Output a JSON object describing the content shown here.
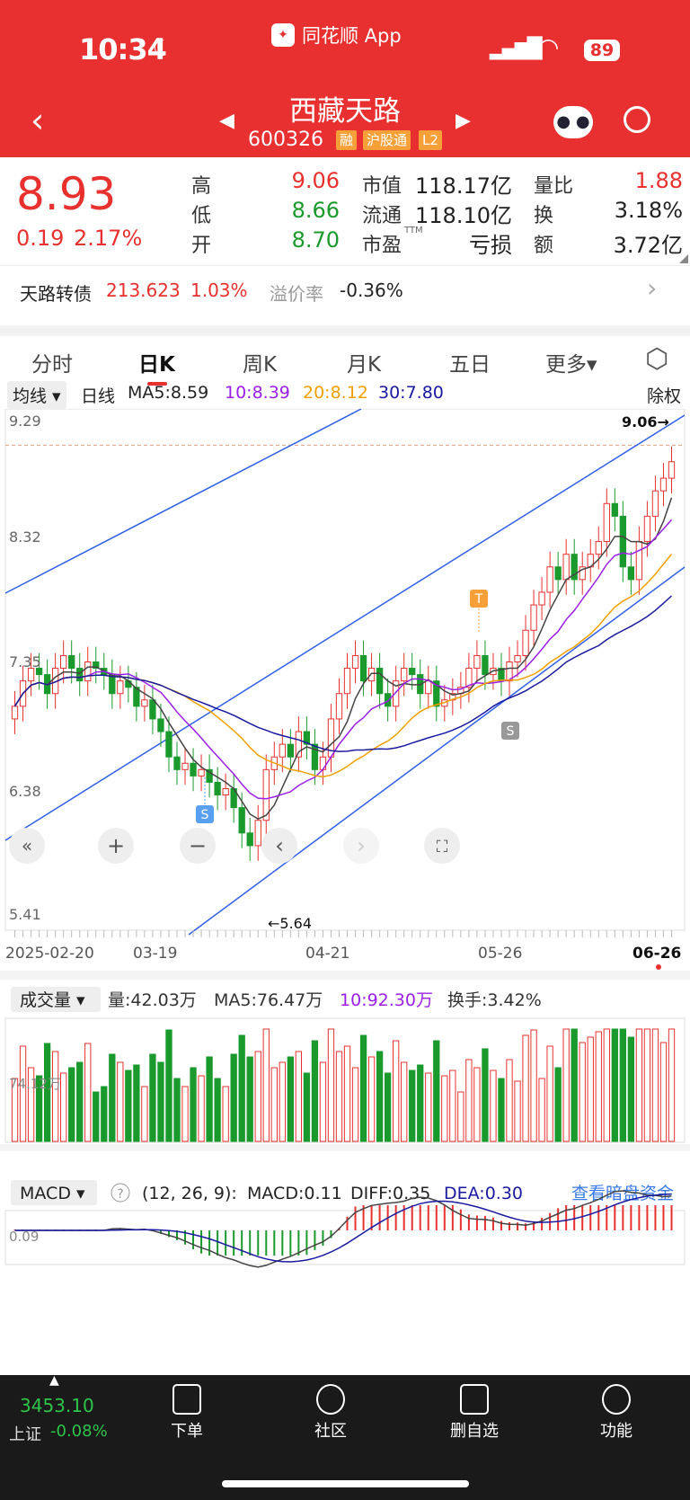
{
  "status": {
    "time": "10:34",
    "app": "同花顺 App",
    "battery": "89"
  },
  "header": {
    "name": "西藏天路",
    "code": "600326",
    "tags": [
      "融",
      "沪股通",
      "L2"
    ]
  },
  "quote": {
    "price": "8.93",
    "change": "0.19",
    "change_pct": "2.17%",
    "high_label": "高",
    "high": "9.06",
    "low_label": "低",
    "low": "8.66",
    "open_label": "开",
    "open": "8.70",
    "mktcap_label": "市值",
    "mktcap": "118.17亿",
    "float_label": "流通",
    "float": "118.10亿",
    "pe_label": "市盈",
    "pe_sup": "TTM",
    "pe": "亏损",
    "volratio_label": "量比",
    "volratio": "1.88",
    "turnover_label": "换",
    "turnover": "3.18%",
    "amount_label": "额",
    "amount": "3.72亿"
  },
  "bond": {
    "name": "天路转债",
    "price": "213.623",
    "pct": "1.03%",
    "premium_label": "溢价率",
    "premium": "-0.36%"
  },
  "tabs": [
    "分时",
    "日K",
    "周K",
    "月K",
    "五日",
    "更多▾"
  ],
  "ma": {
    "select": "均线 ▾",
    "period": "日线",
    "ma5": "MA5:8.59",
    "ma10": "10:8.39",
    "ma20": "20:8.12",
    "ma30": "30:7.80",
    "adjust": "除权"
  },
  "kline": {
    "y_labels": [
      "9.29",
      "8.32",
      "7.35",
      "6.38",
      "5.41"
    ],
    "x_labels": [
      "2025-02-20",
      "03-19",
      "04-21",
      "05-26",
      "06-26"
    ],
    "max_label": "9.06→",
    "min_label": "←5.64",
    "marker_t": "T",
    "marker_s": "S"
  },
  "volume": {
    "select": "成交量 ▾",
    "vol": "量:42.03万",
    "ma5": "MA5:76.47万",
    "ma10": "10:92.30万",
    "turnover": "换手:3.42%",
    "axis": "74.12万"
  },
  "macd": {
    "select": "MACD ▾",
    "help": "?",
    "params": "(12, 26, 9):",
    "macd": "MACD:0.11",
    "diff": "DIFF:0.35",
    "dea": "DEA:0.30",
    "link": "查看暗盘资金",
    "axis": "0.09"
  },
  "chart_data": {
    "type": "candlestick",
    "x_range": [
      "2025-02-20",
      "2025-06-26"
    ],
    "ylim": [
      5.41,
      9.29
    ],
    "high": 9.06,
    "low": 5.64,
    "last_close": 8.93,
    "closes_approx": [
      7.0,
      7.2,
      7.3,
      7.25,
      7.1,
      7.3,
      7.4,
      7.3,
      7.2,
      7.35,
      7.3,
      7.25,
      7.1,
      7.2,
      7.15,
      7.0,
      7.05,
      6.9,
      6.8,
      6.6,
      6.5,
      6.55,
      6.45,
      6.5,
      6.4,
      6.3,
      6.35,
      6.2,
      6.0,
      5.9,
      6.1,
      6.5,
      6.6,
      6.7,
      6.6,
      6.8,
      6.7,
      6.5,
      6.6,
      6.9,
      7.1,
      7.3,
      7.4,
      7.2,
      7.3,
      7.1,
      7.0,
      7.2,
      7.3,
      7.25,
      7.1,
      7.2,
      7.0,
      7.05,
      7.1,
      7.15,
      7.3,
      7.4,
      7.25,
      7.3,
      7.2,
      7.35,
      7.4,
      7.6,
      7.8,
      7.9,
      8.1,
      8.0,
      8.2,
      8.0,
      8.1,
      8.2,
      8.3,
      8.6,
      8.5,
      8.1,
      8.0,
      8.3,
      8.5,
      8.7,
      8.8,
      8.93
    ],
    "ma_legend": {
      "MA5": 8.59,
      "MA10": 8.39,
      "MA20": 8.12,
      "MA30": 7.8
    }
  },
  "market": {
    "index": "3453.10",
    "name": "上证",
    "pct": "-0.08%"
  },
  "nav": [
    "下单",
    "社区",
    "删自选",
    "功能"
  ],
  "colors": {
    "red": "#e8312f",
    "green": "#1a9a2c",
    "ma10": "#9b1fe8",
    "ma20": "#f0a000",
    "ma30": "#1a1aa0",
    "channel": "#3060e8"
  }
}
